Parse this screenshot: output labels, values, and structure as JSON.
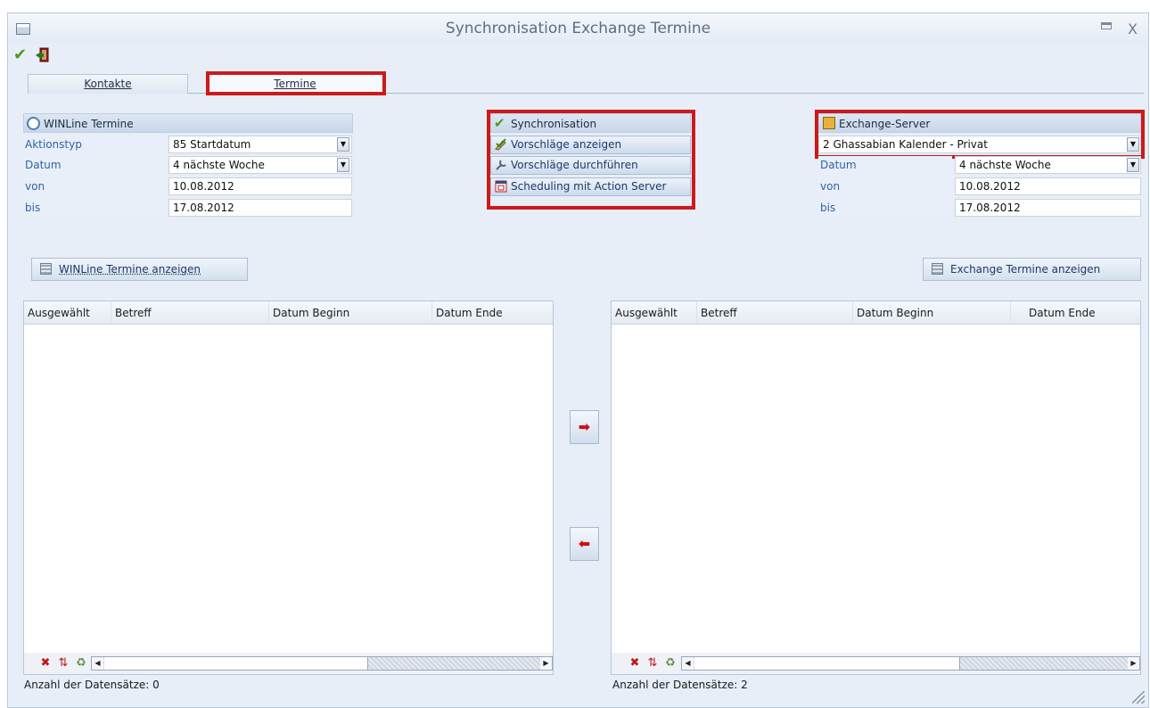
{
  "window": {
    "title": "Synchronisation Exchange Termine",
    "minimize_icon": "minimize-icon",
    "close_symbol": "X"
  },
  "toolbar": {
    "ok_icon": "check-icon",
    "ok_symbol": "✔",
    "exit_icon": "exit-door-icon"
  },
  "tabs": [
    {
      "label": "Kontakte",
      "active": false
    },
    {
      "label": "Termine",
      "active": true
    }
  ],
  "winline": {
    "header": "WINLine Termine",
    "header_icon": "clock-icon",
    "fields": [
      {
        "label": "Aktionstyp",
        "value": "85 Startdatum",
        "dropdown": true
      },
      {
        "label": "Datum",
        "value": "4 nächste Woche",
        "dropdown": true
      },
      {
        "label": "von",
        "value": "10.08.2012",
        "dropdown": false
      },
      {
        "label": "bis",
        "value": "17.08.2012",
        "dropdown": false
      }
    ],
    "show_button": "WINLine Termine anzeigen"
  },
  "sync": {
    "header": "Synchronisation",
    "header_icon": "check-icon",
    "buttons": [
      {
        "label": "Vorschläge anzeigen",
        "icon": "pencil-check-icon"
      },
      {
        "label": "Vorschläge durchführen",
        "icon": "wrench-icon"
      },
      {
        "label": "Scheduling mit Action Server",
        "icon": "calendar-icon"
      }
    ]
  },
  "exchange": {
    "header": "Exchange-Server",
    "header_icon": "exchange-server-icon",
    "server_value": "2  Ghassabian Kalender - Privat",
    "fields": [
      {
        "label": "Datum",
        "value": "4 nächste Woche",
        "dropdown": true
      },
      {
        "label": "von",
        "value": "10.08.2012",
        "dropdown": false
      },
      {
        "label": "bis",
        "value": "17.08.2012",
        "dropdown": false
      }
    ],
    "show_button": "Exchange Termine anzeigen"
  },
  "tables": {
    "columns": [
      "Ausgewählt",
      "Betreff",
      "Datum Beginn",
      "Datum Ende"
    ],
    "left_count_label": "Anzahl der Datensätze: 0",
    "right_count_label": "Anzahl der Datensätze: 2",
    "footer_icons": [
      "delete-filter-icon",
      "sort-icon",
      "recycle-icon"
    ]
  },
  "move_buttons": {
    "right_symbol": "➡",
    "left_symbol": "⬅"
  },
  "colors": {
    "highlight": "#cc1a1a",
    "label_blue": "#2f63a5",
    "window_bg": "#e7eef7"
  }
}
